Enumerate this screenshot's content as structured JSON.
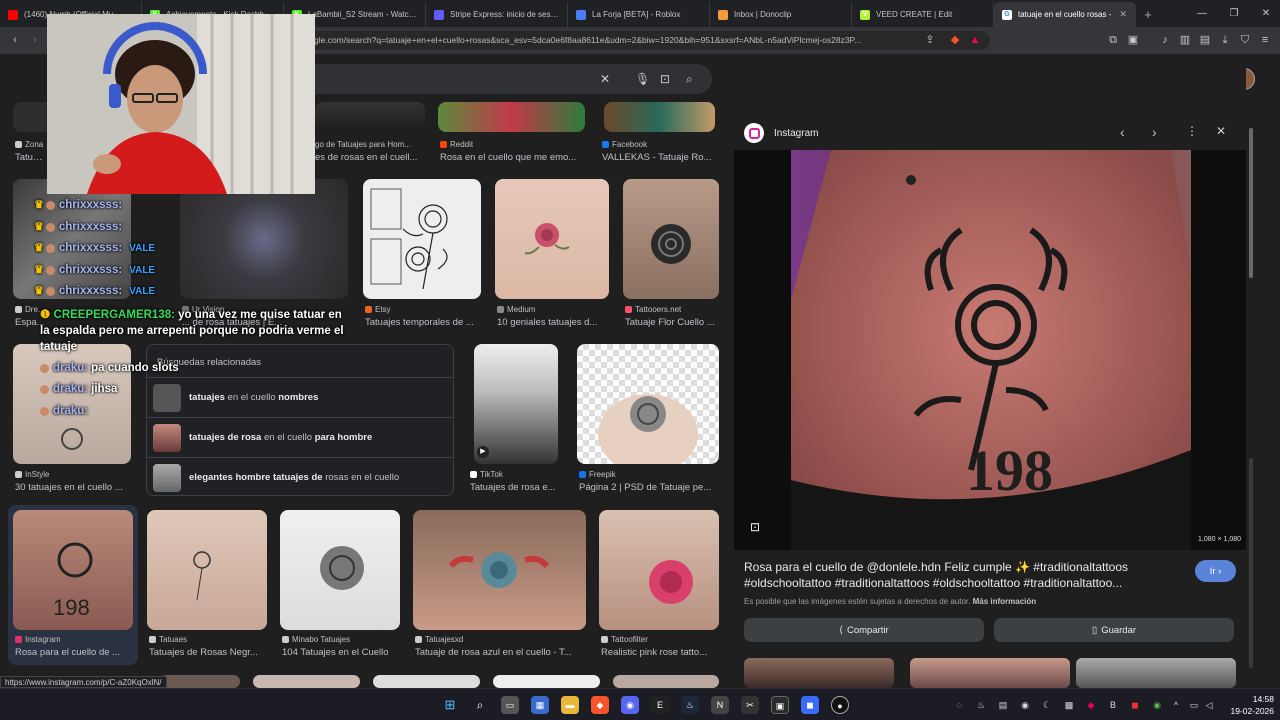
{
  "tabs": [
    {
      "title": "(1460) Numb (Official Mu...",
      "fav_color": "#ff0000",
      "fav": ""
    },
    {
      "title": "Achievements - Kick Dashboar",
      "fav_color": "#53fc18",
      "fav": "K"
    },
    {
      "title": "LaBambii_S2 Stream - Watch L",
      "fav_color": "#53fc18",
      "fav": "K"
    },
    {
      "title": "Stripe Express: inicio de sesión",
      "fav_color": "#635bff",
      "fav": ""
    },
    {
      "title": "La Forja [BETA] - Roblox",
      "fav_color": "#4f7cff",
      "fav": ""
    },
    {
      "title": "Inbox | Donoclip",
      "fav_color": "#f29b3a",
      "fav": ""
    },
    {
      "title": "VEED CREATE | Edit",
      "fav_color": "#b5f23a",
      "fav": "V"
    },
    {
      "title": "tatuaje en el cuello rosas -",
      "fav_color": "#ffffff",
      "fav": "G"
    }
  ],
  "address": {
    "url": "gle.com/search?q=tatuaje+en+el+cuello+rosas&sca_esv=5dca0e6f8aa8611e&udm=2&biw=1920&bih=951&sxsrf=ANbL-n5adViPlcmej-os28z3P..."
  },
  "results_top": [
    {
      "src": "Zona",
      "title": "Tatuaje"
    },
    {
      "src": "",
      "title": "go de Tatuajes para Hom...",
      "sub": "es de rosas en el cuell..."
    },
    {
      "src": "Reddit",
      "title": "Rosa en el cuello que me emo...",
      "color": "#ff4500"
    },
    {
      "src": "Facebook",
      "title": "VALLEKAS - Tatuaje Ro...",
      "color": "#1877f2"
    }
  ],
  "results_row2": [
    {
      "src": "Dre...",
      "title": "Espa..."
    },
    {
      "src": "Ur Vision",
      "title": "... de rosa tatuajes | E..."
    },
    {
      "src": "Etsy",
      "title": "Tatuajes temporales de ...",
      "color": "#f1641e"
    },
    {
      "src": "Medium",
      "title": "10 geniales tatuajes d...",
      "color": "#888888"
    },
    {
      "src": "Tattooers.net",
      "title": "Tatuaje Flor Cuello ...",
      "color": "#ff4f6d"
    }
  ],
  "results_row3": [
    {
      "src": "InStyle",
      "title": "30 tatuajes en el cuello ...",
      "color": "#cccccc"
    },
    {
      "src": "TikTok",
      "title": "Tatuajes de rosa e...",
      "color": "#ffffff"
    },
    {
      "src": "Freepik",
      "title": "Página 2 | PSD de Tatuaje pe...",
      "color": "#1273eb"
    }
  ],
  "results_row4": [
    {
      "src": "Instagram",
      "title": "Rosa para el cuello de ...",
      "color": "#e1306c"
    },
    {
      "src": "Tatuaes",
      "title": "Tatuajes de Rosas Negr...",
      "color": "#cccccc"
    },
    {
      "src": "Minabo Tatuajes",
      "title": "104 Tatuajes en el Cuello",
      "color": "#cccccc"
    },
    {
      "src": "Tatuajesxd",
      "title": "Tatuaje de rosa azul en el cuello - T...",
      "color": "#cccccc"
    },
    {
      "src": "Tattoofilter",
      "title": "Realistic pink rose tatto...",
      "color": "#cccccc"
    }
  ],
  "related": {
    "heading": "Búsquedas relacionadas",
    "rows": [
      {
        "bold1": "tatuajes",
        "plain": " en el cuello ",
        "bold2": "nombres"
      },
      {
        "bold1": "tatuajes de rosa",
        "plain": " en el cuello ",
        "bold2": "para hombre"
      },
      {
        "bold1": "elegantes hombre tatuajes de",
        "plain": " rosas en el cuello",
        "bold2": ""
      }
    ]
  },
  "panel": {
    "source": "Instagram",
    "dims": "1,080 × 1,080",
    "title": "Rosa para el cuello de @donlele.hdn Feliz cumple ✨ #traditionaltattoos #oldschooltattoo #traditionaltattoos #oldschooltattoo #traditionaltattoo...",
    "note": "Es posible que las imágenes estén sujetas a derechos de autor.",
    "note_link": "Más información",
    "ir": "Ir",
    "share": "Compartir",
    "save": "Guardar"
  },
  "chat": [
    {
      "user": "chrixxxsss:",
      "msg": "",
      "tag": ""
    },
    {
      "user": "chrixxxsss:",
      "msg": "",
      "tag": ""
    },
    {
      "user": "chrixxxsss:",
      "msg": "",
      "tag": "VALE"
    },
    {
      "user": "chrixxxsss:",
      "msg": "",
      "tag": "VALE"
    },
    {
      "user": "chrixxxsss:",
      "msg": "",
      "tag": "VALE"
    }
  ],
  "chat_long": {
    "user": "CREEPERGAMER138:",
    "msg": "yo una vez me quise tatuar en la espalda pero me arrepenti porque no podria verme el tatuaje"
  },
  "chat_tail": [
    {
      "user": "draku:",
      "msg": "pa cuando slots"
    },
    {
      "user": "draku:",
      "msg": "jihsa"
    },
    {
      "user": "draku:",
      "msg": ""
    }
  ],
  "status_url": "https://www.instagram.com/p/C-aZ0KqOxlN/",
  "clock": {
    "time": "14:58",
    "date": "19-02-2026"
  }
}
